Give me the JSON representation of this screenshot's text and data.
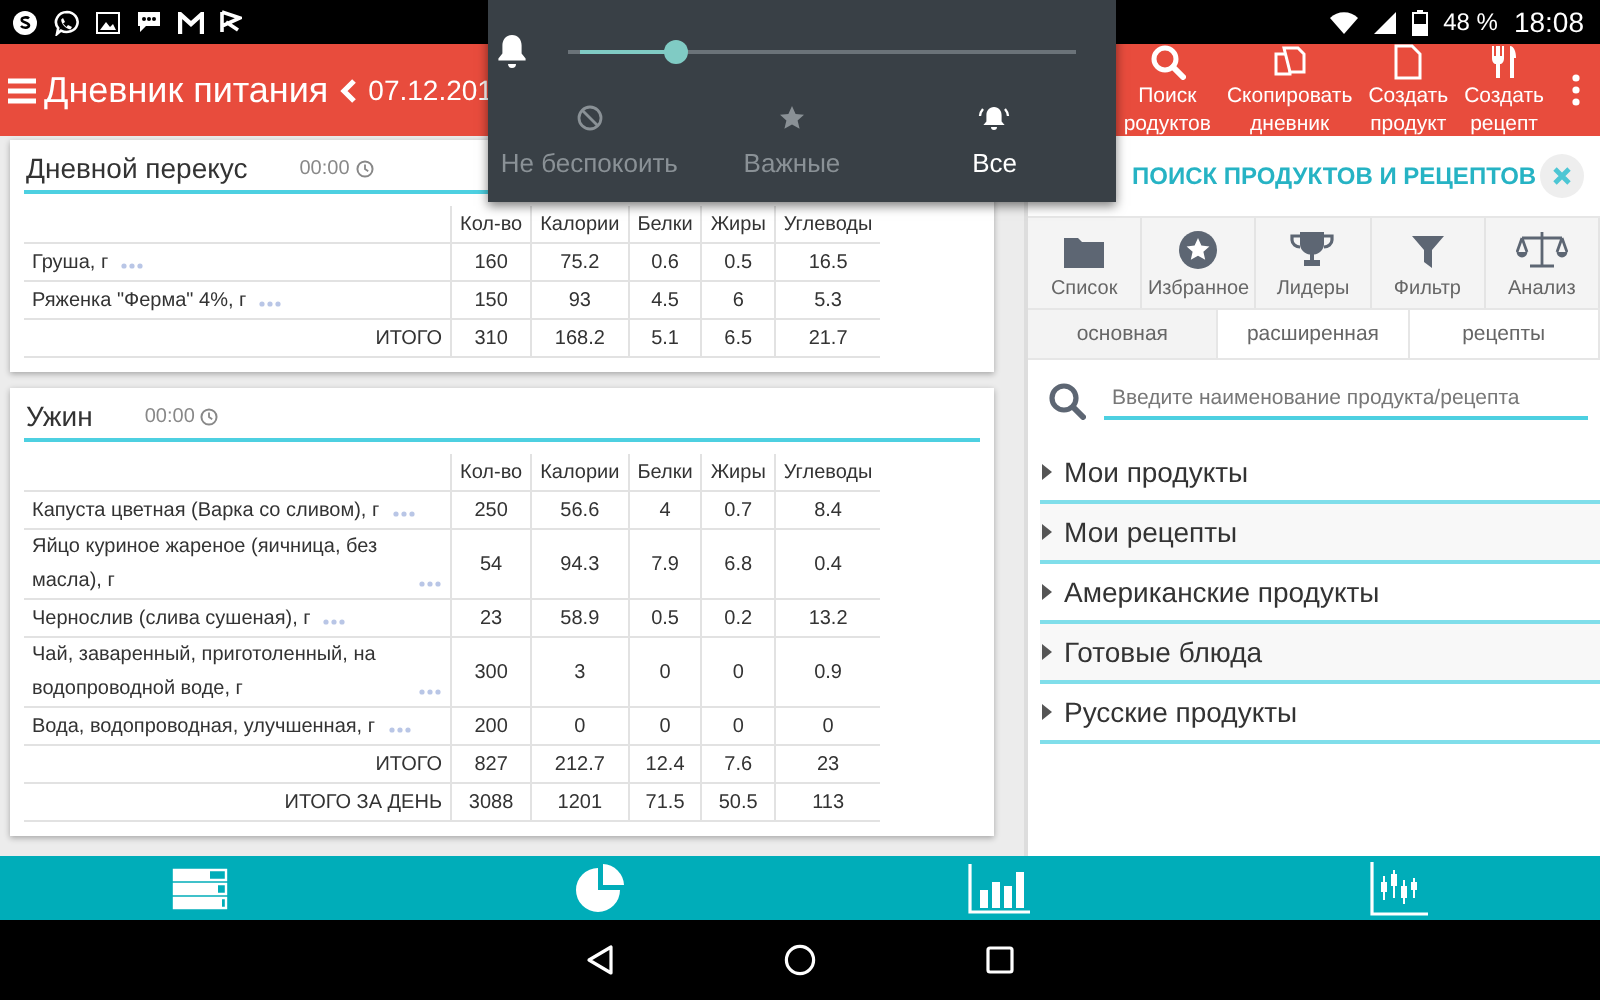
{
  "status_bar": {
    "battery": "48 %",
    "time": "18:08"
  },
  "app_bar": {
    "title": "Дневник питания",
    "date": "07.12.201",
    "actions": [
      {
        "kind": "search",
        "lines": [
          "Поиск",
          "родуктов"
        ]
      },
      {
        "kind": "copy",
        "lines": [
          "Скопировать",
          "дневник"
        ]
      },
      {
        "kind": "document",
        "lines": [
          "Создать",
          "продукт"
        ]
      },
      {
        "kind": "cutlery",
        "lines": [
          "Создать",
          "рецепт"
        ]
      }
    ]
  },
  "volume_panel": {
    "level": 0.2,
    "modes": [
      {
        "kind": "none",
        "label": "Не беспокоить",
        "selected": false
      },
      {
        "kind": "priority",
        "label": "Важные",
        "selected": false
      },
      {
        "kind": "all",
        "label": "Все",
        "selected": true
      }
    ]
  },
  "meals": [
    {
      "name": "Дневной перекус",
      "time": "00:00",
      "columns": [
        "Кол-во",
        "Калории",
        "Белки",
        "Жиры",
        "Углеводы"
      ],
      "rows": [
        {
          "name": "Груша, г",
          "values": [
            "160",
            "75.2",
            "0.6",
            "0.5",
            "16.5"
          ]
        },
        {
          "name": "Ряженка \"Ферма\" 4%, г",
          "values": [
            "150",
            "93",
            "4.5",
            "6",
            "5.3"
          ]
        }
      ],
      "totals": [
        {
          "label": "ИТОГО",
          "values": [
            "310",
            "168.2",
            "5.1",
            "6.5",
            "21.7"
          ]
        }
      ]
    },
    {
      "name": "Ужин",
      "time": "00:00",
      "columns": [
        "Кол-во",
        "Калории",
        "Белки",
        "Жиры",
        "Углеводы"
      ],
      "rows": [
        {
          "name": "Капуста цветная (Варка со сливом), г",
          "values": [
            "250",
            "56.6",
            "4",
            "0.7",
            "8.4"
          ]
        },
        {
          "name": "Яйцо куриное жареное (яичница, без масла), г",
          "values": [
            "54",
            "94.3",
            "7.9",
            "6.8",
            "0.4"
          ]
        },
        {
          "name": "Чернослив (слива сушеная), г",
          "values": [
            "23",
            "58.9",
            "0.5",
            "0.2",
            "13.2"
          ]
        },
        {
          "name": "Чай, заваренный, приготоленный, на водопроводной воде, г",
          "values": [
            "300",
            "3",
            "0",
            "0",
            "0.9"
          ]
        },
        {
          "name": "Вода, водопроводная, улучшенная, г",
          "values": [
            "200",
            "0",
            "0",
            "0",
            "0"
          ]
        }
      ],
      "totals": [
        {
          "label": "ИТОГО",
          "values": [
            "827",
            "212.7",
            "12.4",
            "7.6",
            "23"
          ]
        },
        {
          "label": "ИТОГО ЗА ДЕНЬ",
          "values": [
            "3088",
            "1201",
            "71.5",
            "50.5",
            "113"
          ]
        }
      ]
    }
  ],
  "search_panel": {
    "title": "ПОИСК ПРОДУКТОВ И РЕЦЕПТОВ",
    "tools": [
      {
        "kind": "folder",
        "label": "Список"
      },
      {
        "kind": "star",
        "label": "Избранное"
      },
      {
        "kind": "trophy",
        "label": "Лидеры"
      },
      {
        "kind": "filter",
        "label": "Фильтр"
      },
      {
        "kind": "scales",
        "label": "Анализ"
      }
    ],
    "tabs": [
      {
        "label": "основная",
        "selected": true
      },
      {
        "label": "расширенная",
        "selected": false
      },
      {
        "label": "рецепты",
        "selected": false
      }
    ],
    "search": {
      "placeholder": "Введите наименование продукта/рецепта"
    },
    "categories": [
      {
        "label": "Мои продукты",
        "expanded": false
      },
      {
        "label": "Мои рецепты",
        "expanded": false
      },
      {
        "label": "Американские продукты",
        "expanded": false
      },
      {
        "label": "Готовые блюда",
        "expanded": false
      },
      {
        "label": "Русские продукты",
        "expanded": false
      }
    ]
  }
}
